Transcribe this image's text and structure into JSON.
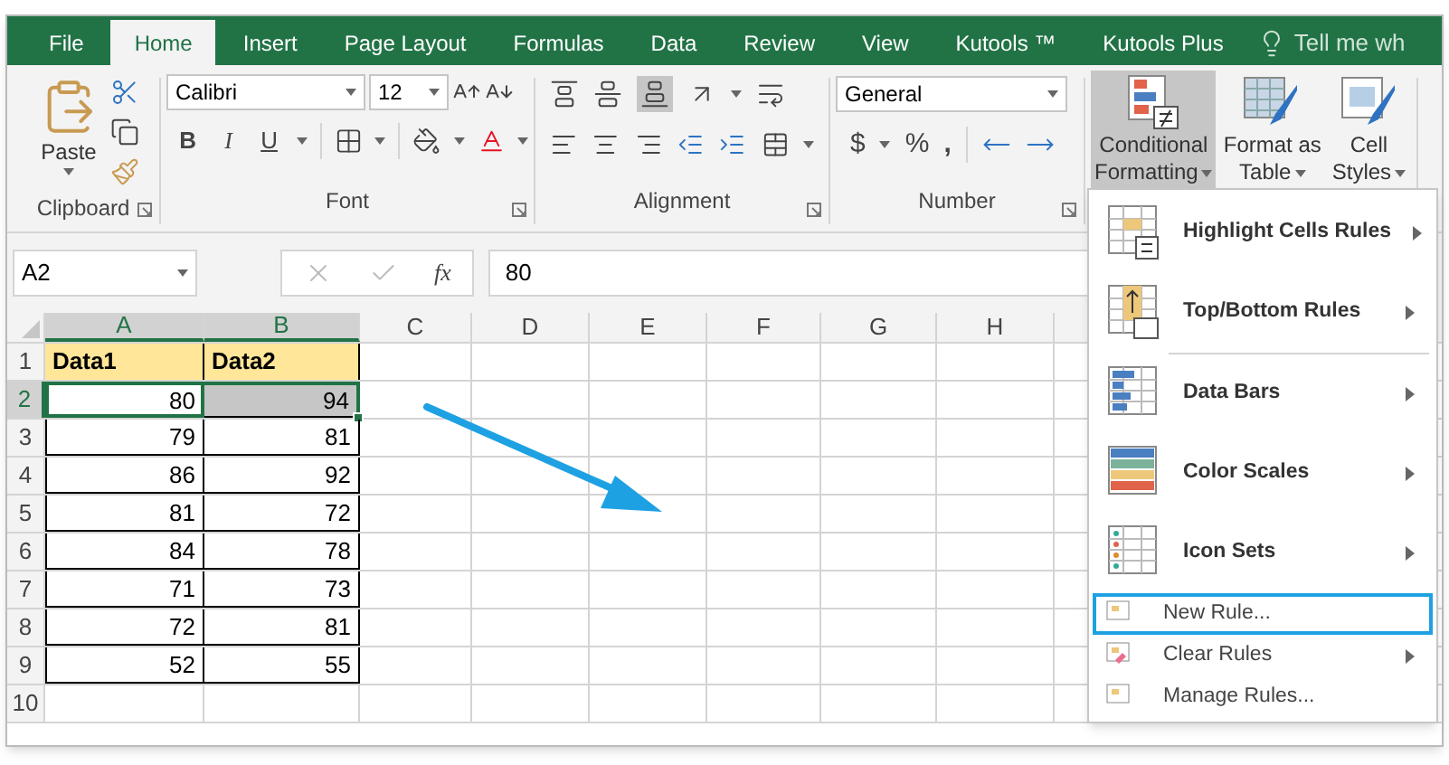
{
  "tabs": [
    {
      "label": "File",
      "selected": false
    },
    {
      "label": "Home",
      "selected": true
    },
    {
      "label": "Insert",
      "selected": false
    },
    {
      "label": "Page Layout",
      "selected": false
    },
    {
      "label": "Formulas",
      "selected": false
    },
    {
      "label": "Data",
      "selected": false
    },
    {
      "label": "Review",
      "selected": false
    },
    {
      "label": "View",
      "selected": false
    },
    {
      "label": "Kutools ™",
      "selected": false
    },
    {
      "label": "Kutools Plus",
      "selected": false
    }
  ],
  "tell_me": "Tell me wh",
  "ribbon": {
    "clipboard": {
      "label": "Clipboard",
      "paste": "Paste"
    },
    "font": {
      "label": "Font",
      "font_name": "Calibri",
      "font_size": "12",
      "bold": "B",
      "italic": "I",
      "underline": "U"
    },
    "alignment": {
      "label": "Alignment"
    },
    "number": {
      "label": "Number",
      "format": "General",
      "currency": "$",
      "percent": "%",
      "comma": ","
    },
    "styles": [
      {
        "lines": [
          "Conditional",
          "Formatting"
        ],
        "selected": true
      },
      {
        "lines": [
          "Format as",
          "Table"
        ],
        "selected": false
      },
      {
        "lines": [
          "Cell",
          "Styles"
        ],
        "selected": false
      }
    ]
  },
  "formula_bar": {
    "name_box": "A2",
    "function_label": "fx",
    "value": "80"
  },
  "sheet": {
    "columns": [
      {
        "label": "A",
        "selected": true
      },
      {
        "label": "B",
        "selected": true
      },
      {
        "label": "C",
        "selected": false
      },
      {
        "label": "D",
        "selected": false
      },
      {
        "label": "E",
        "selected": false
      },
      {
        "label": "F",
        "selected": false
      },
      {
        "label": "G",
        "selected": false
      },
      {
        "label": "H",
        "selected": false
      }
    ],
    "rows": [
      {
        "number": "1",
        "selected": false,
        "cells": [
          {
            "text": "Data1",
            "kind": "header",
            "selected": false,
            "active": false
          },
          {
            "text": "Data2",
            "kind": "header",
            "selected": false,
            "active": false
          }
        ]
      },
      {
        "number": "2",
        "selected": true,
        "cells": [
          {
            "text": "80",
            "kind": "value",
            "selected": true,
            "active": true
          },
          {
            "text": "94",
            "kind": "value",
            "selected": true,
            "active": false
          }
        ]
      },
      {
        "number": "3",
        "selected": false,
        "cells": [
          {
            "text": "79",
            "kind": "value",
            "selected": false,
            "active": false
          },
          {
            "text": "81",
            "kind": "value",
            "selected": false,
            "active": false
          }
        ]
      },
      {
        "number": "4",
        "selected": false,
        "cells": [
          {
            "text": "86",
            "kind": "value",
            "selected": false,
            "active": false
          },
          {
            "text": "92",
            "kind": "value",
            "selected": false,
            "active": false
          }
        ]
      },
      {
        "number": "5",
        "selected": false,
        "cells": [
          {
            "text": "81",
            "kind": "value",
            "selected": false,
            "active": false
          },
          {
            "text": "72",
            "kind": "value",
            "selected": false,
            "active": false
          }
        ]
      },
      {
        "number": "6",
        "selected": false,
        "cells": [
          {
            "text": "84",
            "kind": "value",
            "selected": false,
            "active": false
          },
          {
            "text": "78",
            "kind": "value",
            "selected": false,
            "active": false
          }
        ]
      },
      {
        "number": "7",
        "selected": false,
        "cells": [
          {
            "text": "71",
            "kind": "value",
            "selected": false,
            "active": false
          },
          {
            "text": "73",
            "kind": "value",
            "selected": false,
            "active": false
          }
        ]
      },
      {
        "number": "8",
        "selected": false,
        "cells": [
          {
            "text": "72",
            "kind": "value",
            "selected": false,
            "active": false
          },
          {
            "text": "81",
            "kind": "value",
            "selected": false,
            "active": false
          }
        ]
      },
      {
        "number": "9",
        "selected": false,
        "cells": [
          {
            "text": "52",
            "kind": "value",
            "selected": false,
            "active": false
          },
          {
            "text": "55",
            "kind": "value",
            "selected": false,
            "active": false
          }
        ]
      },
      {
        "number": "10",
        "selected": false
      }
    ]
  },
  "menu": {
    "items": [
      {
        "label": "Highlight Cells Rules",
        "kind": "large",
        "submenu": true,
        "selected": false
      },
      {
        "label": "Top/Bottom Rules",
        "kind": "large",
        "submenu": true,
        "selected": false
      },
      {
        "label": "Data Bars",
        "kind": "large",
        "submenu": true,
        "selected": false
      },
      {
        "label": "Color Scales",
        "kind": "large",
        "submenu": true,
        "selected": false
      },
      {
        "label": "Icon Sets",
        "kind": "large",
        "submenu": true,
        "selected": false
      },
      {
        "label": "New Rule...",
        "kind": "small",
        "submenu": false,
        "selected": true
      },
      {
        "label": "Clear Rules",
        "kind": "small",
        "submenu": true,
        "selected": false
      },
      {
        "label": "Manage Rules...",
        "kind": "small",
        "submenu": false,
        "selected": false
      }
    ]
  }
}
